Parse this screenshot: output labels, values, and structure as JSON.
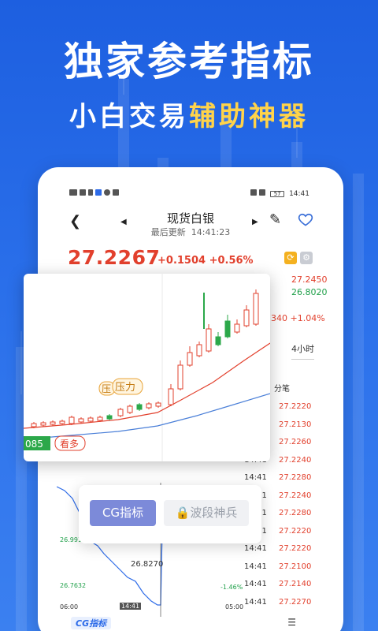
{
  "hero": {
    "title": "独家参考指标",
    "subtitle_white": "小白交易",
    "subtitle_yellow": "辅助神器"
  },
  "statusbar": {
    "time": "14:41",
    "battery": "57"
  },
  "nav": {
    "title": "现货白银",
    "updated_label": "最后更新",
    "updated_time": "14:41:23"
  },
  "quote": {
    "price": "27.2267",
    "change": "+0.1504",
    "change_pct": "+0.56%",
    "high": "27.2450",
    "low": "26.8020",
    "change_pct2": "340 +1.04%",
    "period": "4小时",
    "trade_header": "分笔"
  },
  "trades": [
    {
      "time": "",
      "price": "27.2220"
    },
    {
      "time": "",
      "price": "27.2130"
    },
    {
      "time": "",
      "price": "27.2260"
    },
    {
      "time": "14:41",
      "price": "27.2240"
    },
    {
      "time": "14:41",
      "price": "27.2280"
    },
    {
      "time": "14:41",
      "price": "27.2240"
    },
    {
      "time": "14:41",
      "price": "27.2280"
    },
    {
      "time": "14:41",
      "price": "27.2220"
    },
    {
      "time": "14:41",
      "price": "27.2220"
    },
    {
      "time": "14:41",
      "price": "27.2100"
    },
    {
      "time": "14:41",
      "price": "27.2140"
    },
    {
      "time": "14:41",
      "price": "27.2270"
    }
  ],
  "mini_chart": {
    "label_top": "26.9919",
    "label_low": "26.7632",
    "label_mid": "26.8270",
    "x_start": "06:00",
    "x_cursor": "14:41",
    "x_end": "05:00",
    "pct": "-1.46%"
  },
  "overlay": {
    "badge_price": "085",
    "bullish_label": "看多",
    "pressure_label1": "压",
    "pressure_label2": "压力"
  },
  "indicators": {
    "cg_label": "CG指标",
    "wave_label": "波段神兵",
    "cg_bottom": "CG指标"
  },
  "colors": {
    "up": "#e2402d",
    "down": "#20a04a",
    "accent": "#2a6fea",
    "gold": "#ffd34a"
  }
}
